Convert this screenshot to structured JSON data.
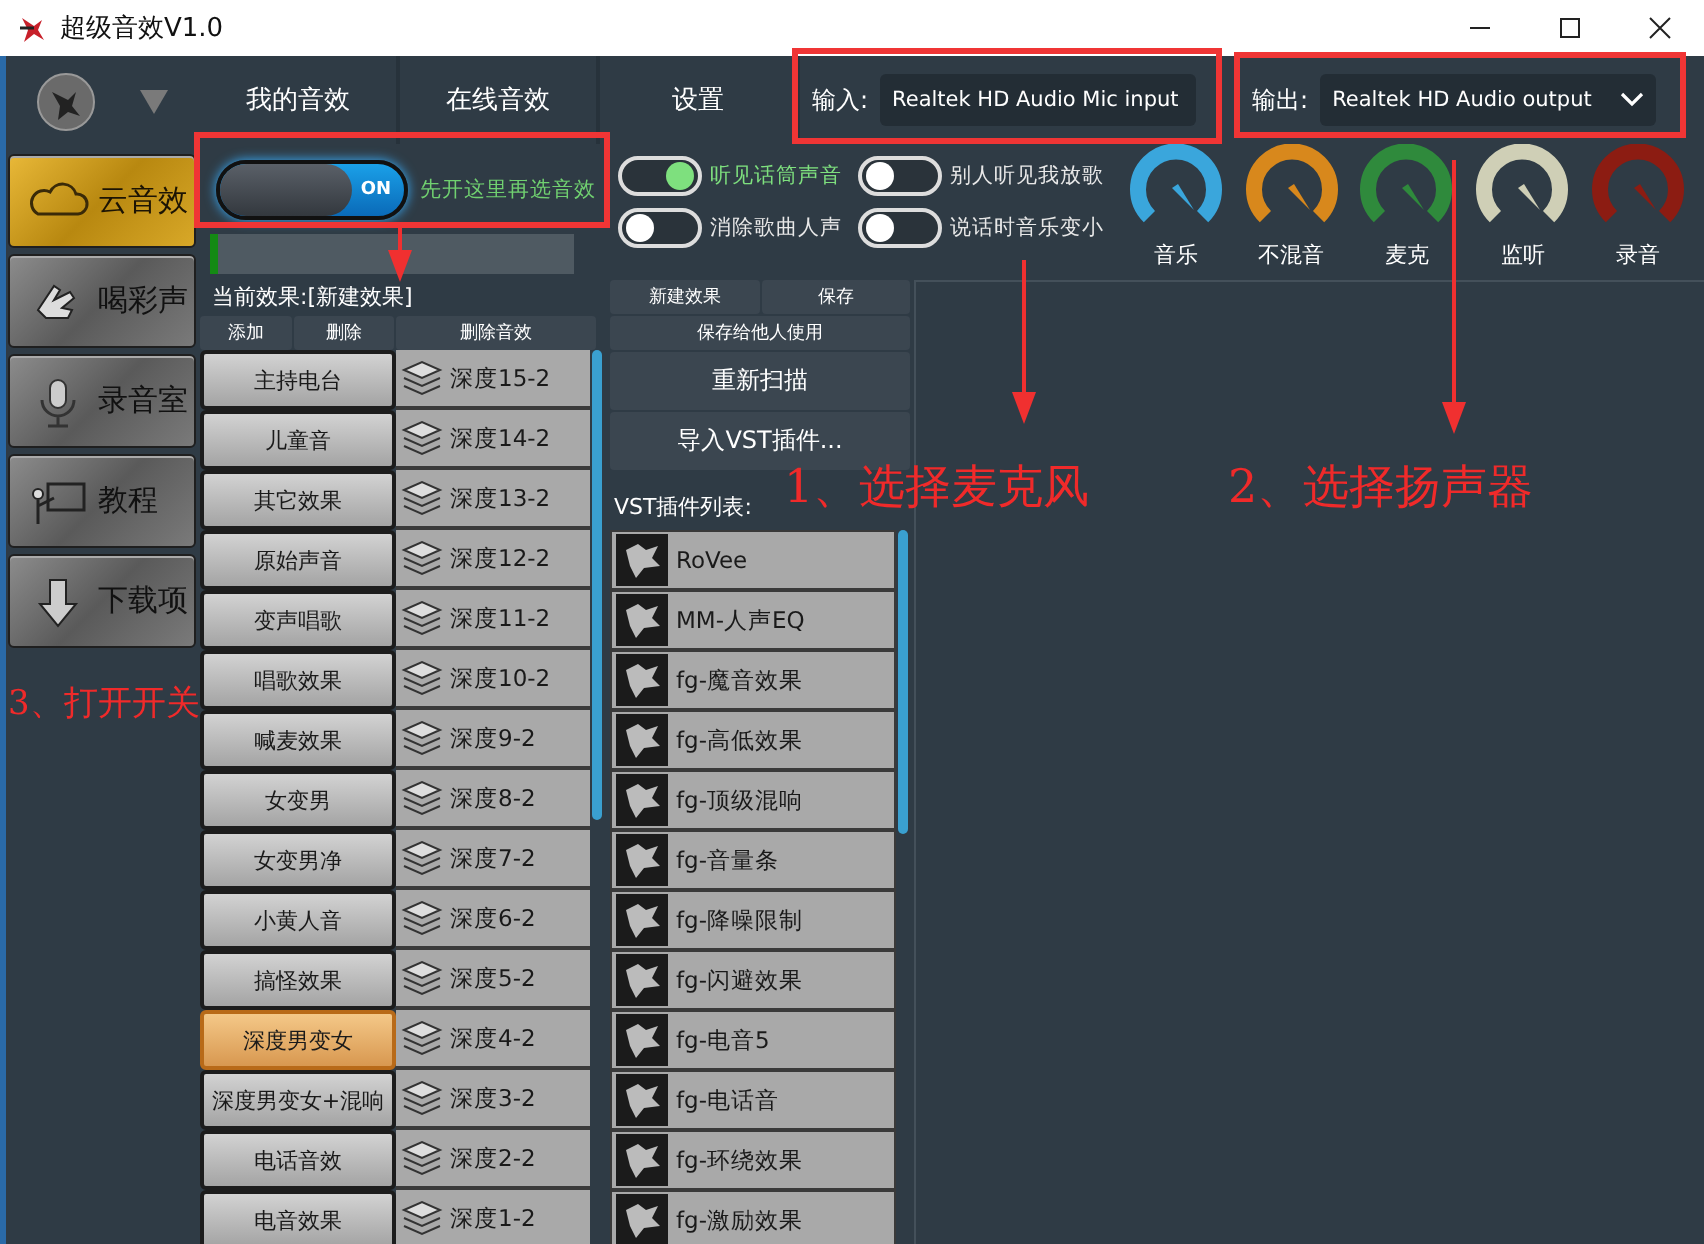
{
  "window": {
    "title": "超级音效V1.0"
  },
  "sidebar": {
    "items": [
      {
        "label": "云音效",
        "selected": true
      },
      {
        "label": "喝彩声",
        "selected": false
      },
      {
        "label": "录音室",
        "selected": false
      },
      {
        "label": "教程",
        "selected": false
      },
      {
        "label": "下载项",
        "selected": false
      }
    ]
  },
  "tabs": [
    {
      "label": "我的音效"
    },
    {
      "label": "在线音效"
    },
    {
      "label": "设置"
    }
  ],
  "devices": [
    {
      "label": "输入:",
      "value": "Realtek HD Audio Mic input"
    },
    {
      "label": "输出:",
      "value": "Realtek HD Audio output"
    }
  ],
  "power": {
    "state": "ON",
    "on": true,
    "hint": "先开这里再选音效"
  },
  "meter": {
    "level": 0.02
  },
  "toggles": [
    {
      "label": "听见话筒声音",
      "on": true
    },
    {
      "label": "别人听见我放歌",
      "on": false
    },
    {
      "label": "消除歌曲人声",
      "on": false
    },
    {
      "label": "说话时音乐变小",
      "on": false
    }
  ],
  "knobs": [
    {
      "label": "音乐",
      "color": "#3aa6dc"
    },
    {
      "label": "不混音",
      "color": "#d8881c"
    },
    {
      "label": "麦克",
      "color": "#2f8a3c"
    },
    {
      "label": "监听",
      "color": "#cfcfb6"
    },
    {
      "label": "录音",
      "color": "#8c1c12"
    }
  ],
  "current_effect": "当前效果:[新建效果]",
  "effect_buttons": [
    "添加",
    "删除",
    "删除音效"
  ],
  "effects": [
    {
      "name": "主持电台",
      "preset": "深度15-2",
      "selected": false
    },
    {
      "name": "儿童音",
      "preset": "深度14-2",
      "selected": false
    },
    {
      "name": "其它效果",
      "preset": "深度13-2",
      "selected": false
    },
    {
      "name": "原始声音",
      "preset": "深度12-2",
      "selected": false
    },
    {
      "name": "变声唱歌",
      "preset": "深度11-2",
      "selected": false
    },
    {
      "name": "唱歌效果",
      "preset": "深度10-2",
      "selected": false
    },
    {
      "name": "喊麦效果",
      "preset": "深度9-2",
      "selected": false
    },
    {
      "name": "女变男",
      "preset": "深度8-2",
      "selected": false
    },
    {
      "name": "女变男净",
      "preset": "深度7-2",
      "selected": false
    },
    {
      "name": "小黄人音",
      "preset": "深度6-2",
      "selected": false
    },
    {
      "name": "搞怪效果",
      "preset": "深度5-2",
      "selected": false
    },
    {
      "name": "深度男变女",
      "preset": "深度4-2",
      "selected": true
    },
    {
      "name": "深度男变女+混响",
      "preset": "深度3-2",
      "selected": false
    },
    {
      "name": "电话音效",
      "preset": "深度2-2",
      "selected": false
    },
    {
      "name": "电音效果",
      "preset": "深度1-2",
      "selected": false
    }
  ],
  "preset_buttons": [
    "新建效果",
    "保存",
    "保存给他人使用",
    "重新扫描",
    "导入VST插件..."
  ],
  "vst_label": "VST插件列表:",
  "vst_plugins": [
    "RoVee",
    "MM-人声EQ",
    "fg-魔音效果",
    "fg-高低效果",
    "fg-顶级混响",
    "fg-音量条",
    "fg-降噪限制",
    "fg-闪避效果",
    "fg-电音5",
    "fg-电话音",
    "fg-环绕效果",
    "fg-激励效果"
  ],
  "annotations": [
    "3、打开开关",
    "1、选择麦克风",
    "2、选择扬声器"
  ]
}
